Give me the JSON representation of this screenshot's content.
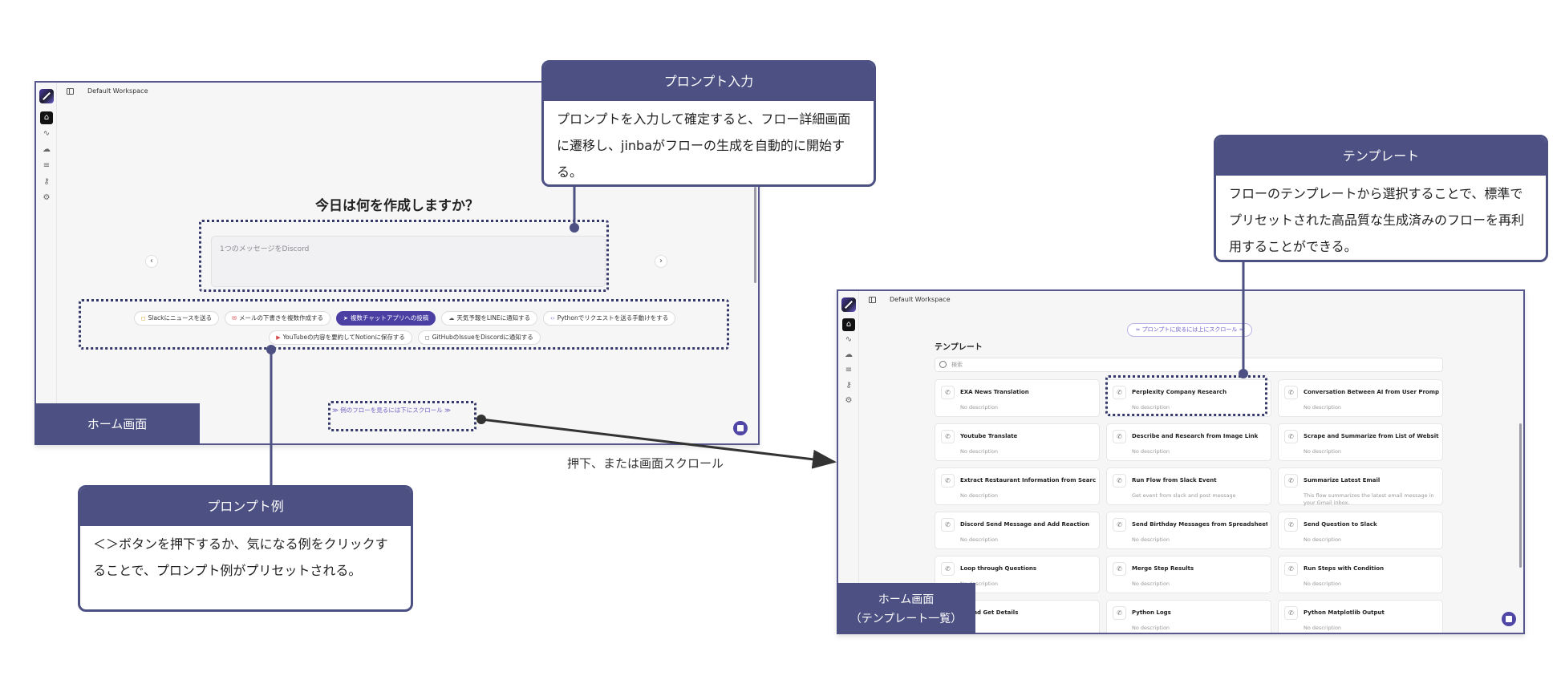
{
  "workspace_name": "Default Workspace",
  "home": {
    "heading": "今日は何を作成しますか？",
    "prompt_placeholder": "1つのメッセージをDiscord",
    "prev_arrow": "‹",
    "next_arrow": "›",
    "chips": [
      {
        "icon": "◻",
        "label": "Slackにニュースを送る",
        "icon_color": "#d9a21a",
        "selected": false
      },
      {
        "icon": "✉",
        "label": "メールの下書きを複数作成する",
        "icon_color": "#d64545",
        "selected": false
      },
      {
        "icon": "➤",
        "label": "複数チャットアプリへの投稿",
        "icon_color": "#ffffff",
        "selected": true
      },
      {
        "icon": "☁",
        "label": "天気予報をLINEに通知する",
        "icon_color": "#555555",
        "selected": false
      },
      {
        "icon": "‹›",
        "label": "Pythonでリクエストを送る手動けをする",
        "icon_color": "#7a6dd1",
        "selected": false
      },
      {
        "icon": "▶",
        "label": "YouTubeの内容を要約してNotionに保存する",
        "icon_color": "#d64545",
        "selected": false
      },
      {
        "icon": "◻",
        "label": "GitHubのIssueをDiscordに通知する",
        "icon_color": "#555555",
        "selected": false
      }
    ],
    "scroll_hint": "≫ 例のフローを見るには下にスクロール ≫"
  },
  "templates_view": {
    "back_pill": "≈ プロンプトに戻るには上にスクロール ≈",
    "heading": "テンプレート",
    "search_placeholder": "検索",
    "cards": [
      {
        "name": "EXA News Translation",
        "desc": "No description"
      },
      {
        "name": "Perplexity Company Research",
        "desc": "No description"
      },
      {
        "name": "Conversation Between AI from User Prompt",
        "desc": "No description"
      },
      {
        "name": "Youtube Translate",
        "desc": "No description"
      },
      {
        "name": "Describe and Research from Image Link",
        "desc": "No description"
      },
      {
        "name": "Scrape and Summarize from List of Websites",
        "desc": "No description"
      },
      {
        "name": "Extract Restaurant Information from Search Results",
        "desc": "No description"
      },
      {
        "name": "Run Flow from Slack Event",
        "desc": "Get event from slack and post message"
      },
      {
        "name": "Summarize Latest Email",
        "desc": "This flow summarizes the latest email message in your Gmail inbox."
      },
      {
        "name": "Discord Send Message and Add Reaction",
        "desc": "No description"
      },
      {
        "name": "Send Birthday Messages from Spreadsheet",
        "desc": "No description"
      },
      {
        "name": "Send Question to Slack",
        "desc": "No description"
      },
      {
        "name": "Loop through Questions",
        "desc": "No description"
      },
      {
        "name": "Merge Step Results",
        "desc": "No description"
      },
      {
        "name": "Run Steps with Condition",
        "desc": "No description"
      },
      {
        "name": "es and Get Details",
        "desc": ""
      },
      {
        "name": "Python Logs",
        "desc": "No description"
      },
      {
        "name": "Python Matplotlib Output",
        "desc": "No description"
      }
    ]
  },
  "labels": {
    "home_screen": "ホーム画面",
    "template_screen_line1": "ホーム画面",
    "template_screen_line2": "（テンプレート一覧）",
    "transition_text": "押下、または画面スクロール"
  },
  "callouts": {
    "prompt_input": {
      "title": "プロンプト入力",
      "body": "プロンプトを入力して確定すると、フロー詳細画面に遷移し、jinbaがフローの生成を自動的に開始する。"
    },
    "template": {
      "title": "テンプレート",
      "body": "フローのテンプレートから選択することで、標準でプリセットされた高品質な生成済みのフローを再利用することができる。"
    },
    "prompt_examples": {
      "title": "プロンプト例",
      "body": "＜＞ボタンを押下するか、気になる例をクリックすることで、プロンプト例がプリセットされる。"
    }
  },
  "colors": {
    "accent": "#4c5082",
    "brand_purple": "#4b3fa3",
    "dotted_outline": "#35386a"
  },
  "sidebar_icons": [
    "home-icon",
    "activity-icon",
    "cloud-icon",
    "database-icon",
    "key-icon",
    "settings-icon"
  ]
}
